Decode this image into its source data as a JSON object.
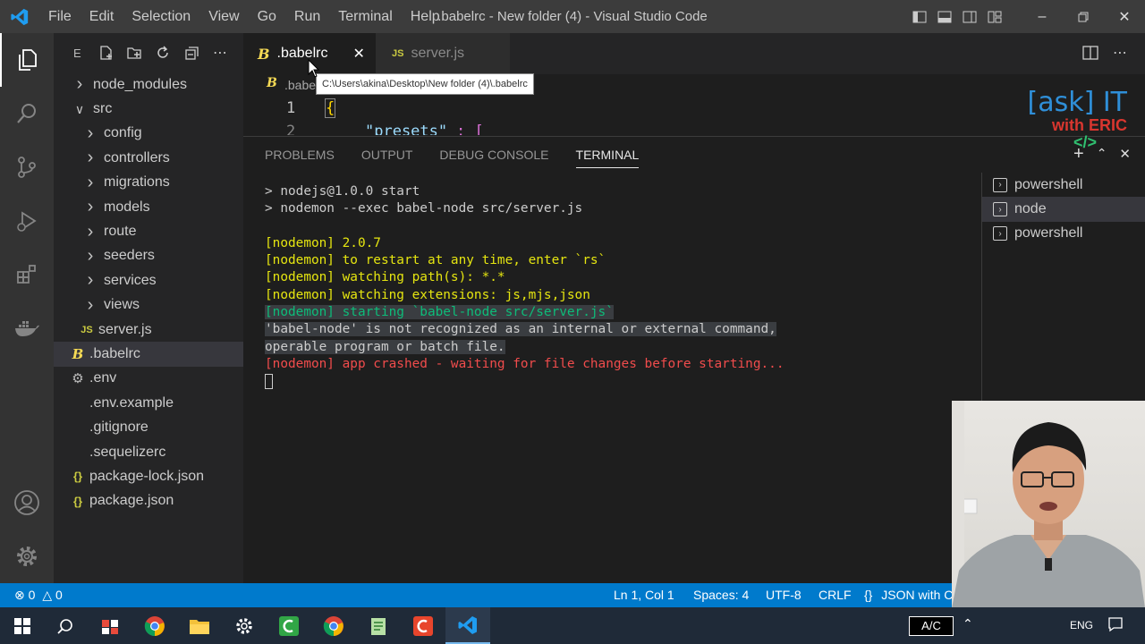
{
  "window": {
    "title": ".babelrc - New folder (4) - Visual Studio Code"
  },
  "menu": [
    "File",
    "Edit",
    "Selection",
    "View",
    "Go",
    "Run",
    "Terminal",
    "Help"
  ],
  "explorer": {
    "label": "E",
    "items": [
      {
        "label": "node_modules",
        "kind": "folder",
        "expanded": false,
        "indent": 1
      },
      {
        "label": "src",
        "kind": "folder",
        "expanded": true,
        "indent": 1
      },
      {
        "label": "config",
        "kind": "folder",
        "expanded": false,
        "indent": 2
      },
      {
        "label": "controllers",
        "kind": "folder",
        "expanded": false,
        "indent": 2
      },
      {
        "label": "migrations",
        "kind": "folder",
        "expanded": false,
        "indent": 2
      },
      {
        "label": "models",
        "kind": "folder",
        "expanded": false,
        "indent": 2
      },
      {
        "label": "route",
        "kind": "folder",
        "expanded": false,
        "indent": 2
      },
      {
        "label": "seeders",
        "kind": "folder",
        "expanded": false,
        "indent": 2
      },
      {
        "label": "services",
        "kind": "folder",
        "expanded": false,
        "indent": 2
      },
      {
        "label": "views",
        "kind": "folder",
        "expanded": false,
        "indent": 2
      },
      {
        "label": "server.js",
        "kind": "js",
        "indent": 2
      },
      {
        "label": ".babelrc",
        "kind": "babel",
        "indent": 1,
        "selected": true
      },
      {
        "label": ".env",
        "kind": "gear",
        "indent": 1
      },
      {
        "label": ".env.example",
        "kind": "plain",
        "indent": 1
      },
      {
        "label": ".gitignore",
        "kind": "plain",
        "indent": 1
      },
      {
        "label": ".sequelizerc",
        "kind": "plain",
        "indent": 1
      },
      {
        "label": "package-lock.json",
        "kind": "json",
        "indent": 1
      },
      {
        "label": "package.json",
        "kind": "json",
        "indent": 1
      }
    ]
  },
  "tabs": [
    {
      "label": ".babelrc",
      "icon": "babel-icon",
      "active": true
    },
    {
      "label": "server.js",
      "icon": "js-icon",
      "active": false
    }
  ],
  "breadcrumb": ".babe",
  "tooltip": "C:\\Users\\akina\\Desktop\\New folder (4)\\.babelrc",
  "editor": {
    "line1_number": "1",
    "line1_code": "{",
    "line2_number": "2",
    "line2_key": "\"presets\"",
    "line2_rest": ": ["
  },
  "panel": {
    "tabs": [
      "PROBLEMS",
      "OUTPUT",
      "DEBUG CONSOLE",
      "TERMINAL"
    ],
    "active_tab": "TERMINAL",
    "terminal_lines": [
      {
        "text": "> nodejs@1.0.0 start",
        "color": "w"
      },
      {
        "text": "> nodemon --exec babel-node src/server.js",
        "color": "w"
      },
      {
        "text": "",
        "color": "w"
      },
      {
        "text": "[nodemon] 2.0.7",
        "color": "y"
      },
      {
        "text": "[nodemon] to restart at any time, enter `rs`",
        "color": "y"
      },
      {
        "text": "[nodemon] watching path(s): *.*",
        "color": "y"
      },
      {
        "text": "[nodemon] watching extensions: js,mjs,json",
        "color": "y"
      },
      {
        "text": "[nodemon] starting `babel-node src/server.js`",
        "color": "g",
        "highlight": true
      },
      {
        "text": "'babel-node' is not recognized as an internal or external command,",
        "color": "w",
        "highlight": true
      },
      {
        "text": "operable program or batch file.",
        "color": "w",
        "highlight": true
      },
      {
        "text": "[nodemon] app crashed - waiting for file changes before starting...",
        "color": "r"
      }
    ],
    "terminals": [
      {
        "label": "powershell",
        "selected": false
      },
      {
        "label": "node",
        "selected": true
      },
      {
        "label": "powershell",
        "selected": false
      }
    ]
  },
  "status": {
    "errors": "0",
    "warnings": "0",
    "position": "Ln 1, Col 1",
    "spaces": "Spaces: 4",
    "encoding": "UTF-8",
    "eol": "CRLF",
    "language": "JSON with C"
  },
  "taskbar": {
    "keyboard": "A/C",
    "lang": "ENG"
  },
  "overlay": {
    "brand_line1": "[ask] IT",
    "brand_line2": "with ERIC"
  },
  "colors": {
    "accent": "#007acc",
    "activity_bar": "#333333",
    "sidebar": "#252526",
    "editor": "#1e1e1e",
    "terminal_yellow": "#e5e510",
    "terminal_green": "#0dbc79",
    "terminal_red": "#f14c4c"
  }
}
